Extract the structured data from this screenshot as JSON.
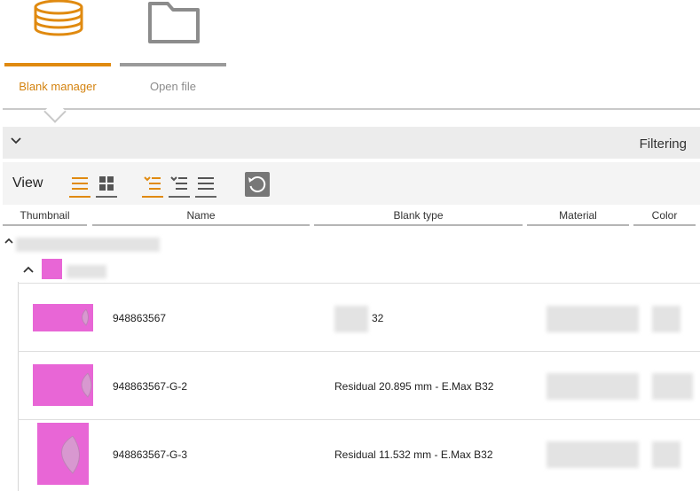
{
  "modes": {
    "blank_manager": "Blank manager",
    "open_file": "Open file"
  },
  "filter": {
    "label": "Filtering"
  },
  "toolbar": {
    "view_label": "View"
  },
  "columns": [
    "Thumbnail",
    "Name",
    "Blank type",
    "Material",
    "Color"
  ],
  "rows": [
    {
      "name": "948863567",
      "blank_type": "32"
    },
    {
      "name": "948863567-G-2",
      "blank_type": "Residual 20.895 mm - E.Max B32"
    },
    {
      "name": "948863567-G-3",
      "blank_type": "Residual 11.532 mm - E.Max B32"
    }
  ],
  "colors": {
    "accent": "#e08a10",
    "inactive_tab": "#8c8c8c",
    "thumbnail": "#e866d6"
  },
  "icons": [
    "coins-icon",
    "folder-icon",
    "chevron-down-icon",
    "chevron-up-icon",
    "list-view-icon",
    "grid-view-icon",
    "filter-list-icon",
    "sort-list-icon",
    "plain-list-icon",
    "reset-icon"
  ]
}
